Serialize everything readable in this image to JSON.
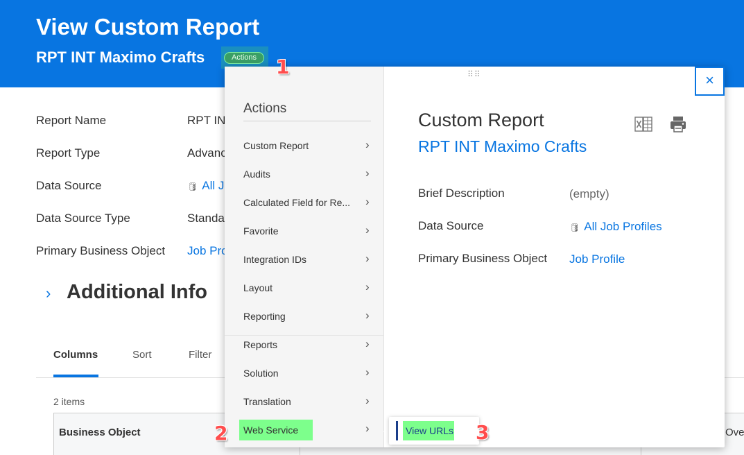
{
  "header": {
    "title": "View Custom Report",
    "subtitle": "RPT INT Maximo Crafts",
    "actions_label": "Actions"
  },
  "callouts": [
    "1",
    "2",
    "3"
  ],
  "details": [
    {
      "label": "Report Name",
      "value": "RPT IN",
      "link": false
    },
    {
      "label": "Report Type",
      "value": "Advanc",
      "link": false
    },
    {
      "label": "Data Source",
      "value": "All J",
      "link": true,
      "icon": "database-icon"
    },
    {
      "label": "Data Source Type",
      "value": "Standa",
      "link": false
    },
    {
      "label": "Primary Business Object",
      "value": "Job Pro",
      "link": true
    }
  ],
  "additional_info": {
    "title": "Additional Info"
  },
  "tabs": [
    {
      "label": "Columns",
      "active": true
    },
    {
      "label": "Sort",
      "active": false
    },
    {
      "label": "Filter",
      "active": false
    }
  ],
  "table": {
    "count": "2 items",
    "headers": [
      "Business Object",
      "Ove"
    ]
  },
  "popup": {
    "menu_title": "Actions",
    "menu_items": [
      "Custom Report",
      "Audits",
      "Calculated Field for Re...",
      "Favorite",
      "Integration IDs",
      "Layout",
      "Reporting",
      "Reports",
      "Solution",
      "Translation",
      "Web Service"
    ],
    "panel_title": "Custom Report",
    "panel_subtitle": "RPT INT Maximo Crafts",
    "fields": [
      {
        "label": "Brief Description",
        "value": "(empty)",
        "link": false
      },
      {
        "label": "Data Source",
        "value": "All Job Profiles",
        "link": true,
        "icon": "database-icon"
      },
      {
        "label": "Primary Business Object",
        "value": "Job Profile",
        "link": true
      }
    ],
    "close_glyph": "×",
    "drag_glyph": "⠿⠿"
  },
  "submenu": {
    "item": "View URLs"
  },
  "colors": {
    "brand_blue": "#0875e1",
    "highlight_green": "#7dff8c",
    "callout_red": "#ff4d4d"
  }
}
